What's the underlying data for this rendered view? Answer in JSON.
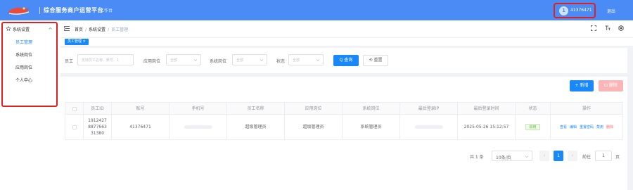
{
  "header": {
    "app_title": "综合服务商户运营平台",
    "workbench": "工作台",
    "user_id": "41376471",
    "avatar_glyph": "1",
    "logout": "退出"
  },
  "sidebar": {
    "group": "系统设置",
    "items": [
      {
        "label": "员工管理",
        "active": true
      },
      {
        "label": "系统岗位",
        "active": false
      },
      {
        "label": "应用岗位",
        "active": false
      },
      {
        "label": "个人中心",
        "active": false
      }
    ]
  },
  "breadcrumb": {
    "home": "首页",
    "section": "系统设置",
    "current": "员工管理"
  },
  "tab": {
    "label": "员工管理 ×"
  },
  "search": {
    "employee_label": "员工",
    "employee_placeholder": "支持员工名称、账号、1",
    "app_role_label": "应用岗位",
    "app_role_placeholder": "全部",
    "sys_role_label": "系统岗位",
    "sys_role_placeholder": "全部",
    "status_label": "状态",
    "status_placeholder": "全部",
    "query": "Q 查询",
    "reset": "⟲ 重置"
  },
  "actions": {
    "add": "+ 新增",
    "delete": "⊡ 删除"
  },
  "table": {
    "headers": [
      "",
      "员工ID",
      "账号",
      "手机号",
      "员工名称",
      "应用岗位",
      "系统岗位",
      "最后登录IP",
      "最后登录时间",
      "状态",
      "操作"
    ],
    "rows": [
      {
        "id_lines": [
          "1912427",
          "8877663",
          "31380"
        ],
        "account": "41376471",
        "name": "超级管理员",
        "app_role": "超级管理员",
        "sys_role": "系统管理员",
        "last_login_time": "2025-05-26 15:12:57",
        "status": "启用",
        "ops": [
          "查看",
          "编辑",
          "重置密码",
          "禁用",
          "删除"
        ]
      }
    ]
  },
  "pager": {
    "total": "共 1 条",
    "page_size": "10条/页",
    "prev": "‹",
    "page": "1",
    "next": "›",
    "goto": "前往",
    "goto_value": "1",
    "unit": "页"
  },
  "colors": {
    "primary": "#1989fa",
    "header_bg": "#4b8bf5",
    "highlight": "#e02020",
    "success": "#67c23a",
    "danger": "#f56c6c"
  }
}
